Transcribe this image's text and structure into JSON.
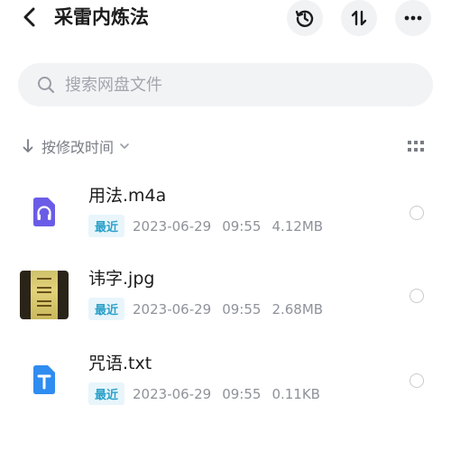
{
  "header": {
    "title": "采雷内炼法",
    "back_icon": "back-arrow-icon",
    "history_icon": "history-icon",
    "sort_icon": "sort-arrows-icon",
    "more_icon": "more-dots-icon"
  },
  "search": {
    "placeholder": "搜索网盘文件",
    "icon": "search-icon"
  },
  "sort": {
    "label": "按修改时间",
    "direction_icon": "arrow-down-icon",
    "dropdown_icon": "chevron-down-icon",
    "view_toggle_icon": "grid-view-icon"
  },
  "files": [
    {
      "name": "用法.m4a",
      "badge": "最近",
      "date": "2023-06-29",
      "time": "09:55",
      "size": "4.12MB",
      "icon": "audio-file-icon"
    },
    {
      "name": "讳字.jpg",
      "badge": "最近",
      "date": "2023-06-29",
      "time": "09:55",
      "size": "2.68MB",
      "icon": "image-thumbnail"
    },
    {
      "name": "咒语.txt",
      "badge": "最近",
      "date": "2023-06-29",
      "time": "09:55",
      "size": "0.11KB",
      "icon": "text-file-icon"
    }
  ],
  "colors": {
    "accent_audio": "#6b5ce7",
    "accent_text": "#2f8cf0",
    "badge_bg": "#e8f5fb",
    "badge_text": "#2aa0c8"
  }
}
